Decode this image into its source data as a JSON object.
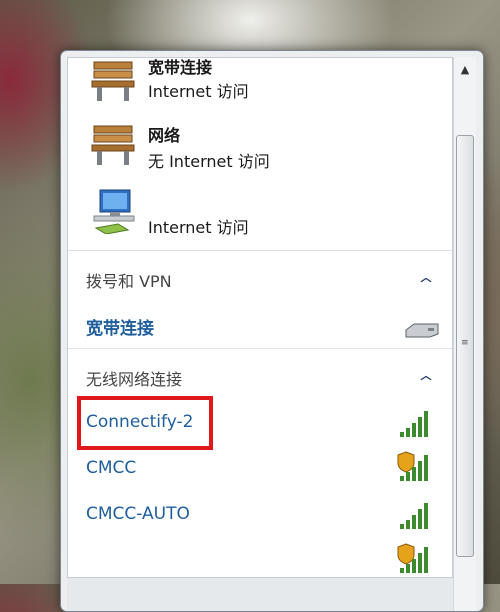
{
  "connections": [
    {
      "name": "宽带连接",
      "status": "Internet 访问",
      "icon": "bench-network-icon"
    },
    {
      "name": "网络",
      "status": "无 Internet 访问",
      "icon": "bench-network-icon"
    },
    {
      "name": "",
      "status": "Internet 访问",
      "icon": "computer-network-icon"
    }
  ],
  "dialup_group": {
    "title": "拨号和 VPN",
    "items": [
      {
        "label": "宽带连接",
        "icon": "modem-icon"
      }
    ]
  },
  "wireless_group": {
    "title": "无线网络连接",
    "networks": [
      {
        "label": "Connectify-2",
        "secured": false,
        "signal": 5
      },
      {
        "label": "CMCC",
        "secured": true,
        "signal": 5
      },
      {
        "label": "CMCC-AUTO",
        "secured": false,
        "signal": 5
      },
      {
        "label": "",
        "secured": true,
        "signal": 5
      }
    ]
  },
  "colors": {
    "link": "#1f5e9c",
    "highlight": "#e0181c",
    "signal": "#3d8b2f"
  }
}
